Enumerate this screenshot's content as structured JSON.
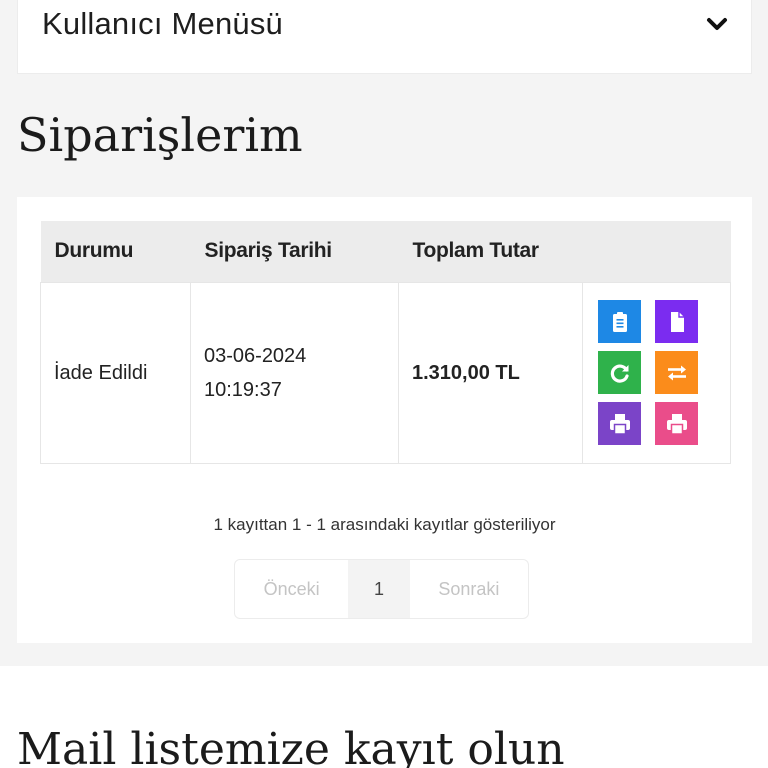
{
  "user_menu": {
    "title": "Kullanıcı Menüsü",
    "toggle_icon": "chevron-down-icon"
  },
  "page": {
    "title": "Siparişlerim"
  },
  "orders_table": {
    "headers": [
      "Durumu",
      "Sipariş Tarihi",
      "Toplam Tutar",
      ""
    ],
    "rows": [
      {
        "status": "İade Edildi",
        "date": "03-06-2024",
        "time": "10:19:37",
        "total": "1.310,00 TL",
        "actions": [
          {
            "icon": "clipboard-icon",
            "color": "#1e88e5"
          },
          {
            "icon": "document-icon",
            "color": "#7b2cf0"
          },
          {
            "icon": "refresh-icon",
            "color": "#2fb24b"
          },
          {
            "icon": "exchange-icon",
            "color": "#fb8c1b"
          },
          {
            "icon": "print-icon",
            "color": "#7b44c8"
          },
          {
            "icon": "print-icon",
            "color": "#ea4d8a"
          }
        ]
      }
    ]
  },
  "pagination": {
    "info": "1 kayıttan 1 - 1 arasındaki kayıtlar gösteriliyor",
    "prev_label": "Önceki",
    "current_page": "1",
    "next_label": "Sonraki"
  },
  "newsletter": {
    "title": "Mail listemize kayıt olun"
  }
}
